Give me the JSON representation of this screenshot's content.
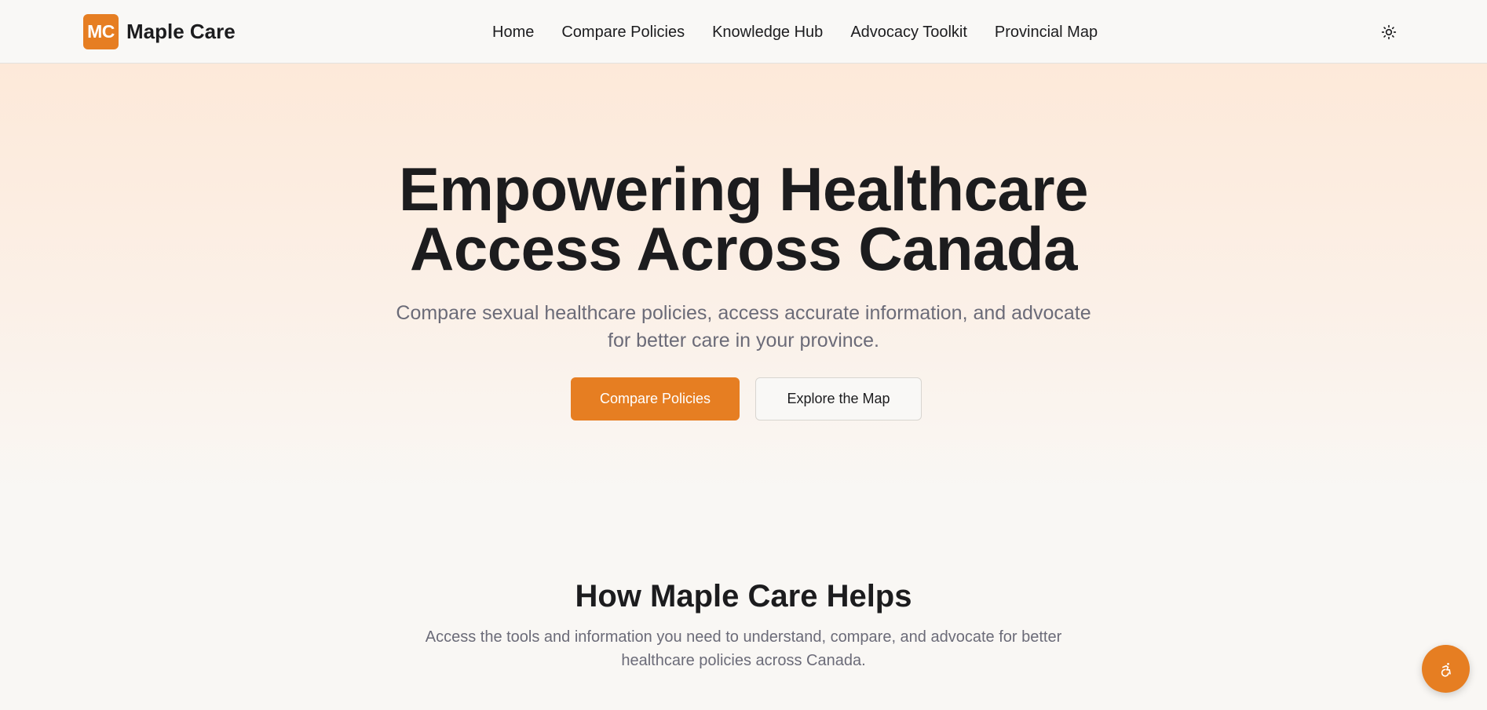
{
  "brand": {
    "logo_text": "MC",
    "name": "Maple Care"
  },
  "nav": {
    "items": [
      {
        "label": "Home"
      },
      {
        "label": "Compare Policies"
      },
      {
        "label": "Knowledge Hub"
      },
      {
        "label": "Advocacy Toolkit"
      },
      {
        "label": "Provincial Map"
      }
    ],
    "theme_toggle_icon": "sun-icon"
  },
  "hero": {
    "title_line1": "Empowering Healthcare",
    "title_line2": "Access Across Canada",
    "subtitle": "Compare sexual healthcare policies, access accurate information, and advocate for better care in your province.",
    "primary_button": "Compare Policies",
    "secondary_button": "Explore the Map"
  },
  "features": {
    "title": "How Maple Care Helps",
    "subtitle": "Access the tools and information you need to understand, compare, and advocate for better healthcare policies across Canada."
  },
  "accessibility_button_icon": "accessibility-icon",
  "colors": {
    "accent": "#e67e22",
    "text": "#1c1c1e",
    "muted": "#6b6b78",
    "background": "#f9f7f4"
  }
}
